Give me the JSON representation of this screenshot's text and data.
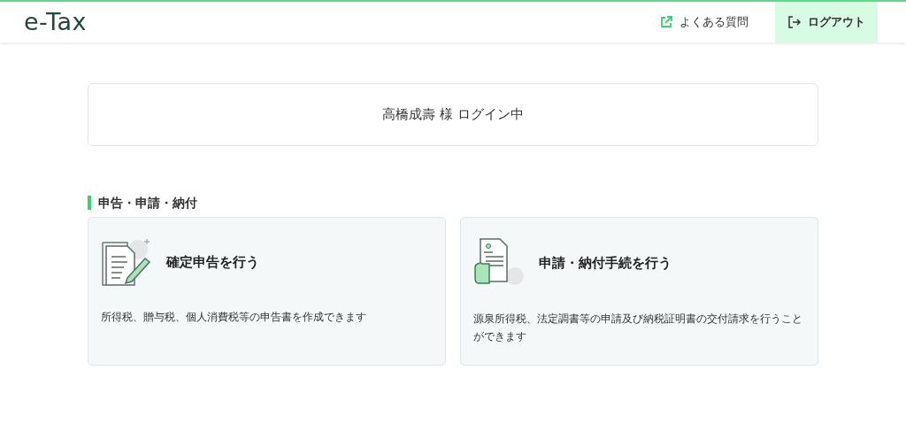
{
  "header": {
    "logo": "e-Tax",
    "links": [
      {
        "kind": "external",
        "label": "よくある質問"
      },
      {
        "kind": "logout",
        "label": "ログアウト"
      }
    ]
  },
  "login_status": "高橋成壽 様 ログイン中",
  "section": {
    "title": "申告・申請・納付",
    "cards": [
      {
        "kind": "return",
        "title": "確定申告を行う",
        "description": "所得税、贈与税、個人消費税等の申告書を作成できます"
      },
      {
        "kind": "application",
        "title": "申請・納付手続を行う",
        "description": "源泉所得税、法定調書等の申請及び納税証明書の交付請求を行うことができます"
      }
    ]
  }
}
